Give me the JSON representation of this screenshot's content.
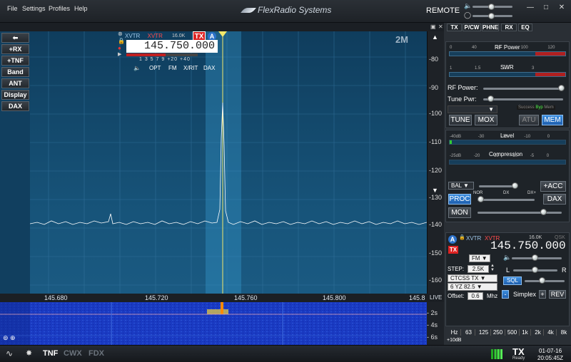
{
  "menubar": {
    "items": [
      "File",
      "Settings",
      "Profiles",
      "Help"
    ],
    "brand": "FlexRadio Systems",
    "remote": "REMOTE",
    "icons": [
      "speaker-icon",
      "headphones-icon"
    ],
    "window_buttons": [
      "—",
      "□",
      "✕"
    ]
  },
  "left_buttons": [
    "+RX",
    "+TNF",
    "Band",
    "ANT",
    "Display",
    "DAX"
  ],
  "panadapter": {
    "band": "2M",
    "db_scale": [
      "-80",
      "-90",
      "-100",
      "-110",
      "-120",
      "-130",
      "-140",
      "-150",
      "-160"
    ],
    "freq_labels": [
      "145.680",
      "145.720",
      "145.760",
      "145.800",
      "145.8"
    ],
    "live": "LIVE"
  },
  "slice": {
    "xvtr_left": "XVTR",
    "xvtr_right": "XVTR",
    "bandwidth": "16.0K",
    "tx": "TX",
    "letter": "A",
    "freq": "145.750.000",
    "scale": "1 3 5 7 9 +20 +40",
    "buttons": [
      "OPT",
      "FM",
      "X/RIT",
      "DAX"
    ]
  },
  "waterfall": {
    "times": [
      "2s",
      "4s",
      "6s"
    ]
  },
  "status": {
    "tnf": "TNF",
    "cwx": "CWX",
    "fdx": "FDX",
    "tx": "TX",
    "ready": "Ready",
    "date": "01-07-16",
    "time": "20:05:45Z"
  },
  "right_tabs": [
    "TX",
    "P/CW",
    "PHNE",
    "RX",
    "EQ"
  ],
  "tx_panel": {
    "rf_power_title": "RF Power",
    "rf_scale": [
      "0",
      "40",
      "80",
      "100",
      "120"
    ],
    "swr_title": "SWR",
    "swr_scale": [
      "1",
      "1.5",
      "2.5",
      "3"
    ],
    "rf_power_label": "RF Power:",
    "tune_pwr_label": "Tune Pwr:",
    "tune": "TUNE",
    "mox": "MOX",
    "atu": "ATU",
    "mem": "MEM",
    "atu_status": [
      "Success",
      "Byp",
      "Mem"
    ]
  },
  "phone_panel": {
    "level_title": "Level",
    "level_scale": [
      "-40dB",
      "-30",
      "-20",
      "-10",
      "0"
    ],
    "comp_title": "Compression",
    "comp_scale": [
      "-25dB",
      "-20",
      "-15",
      "-10",
      "-5",
      "0"
    ],
    "bal": "BAL",
    "acc": "+ACC",
    "proc": "PROC",
    "nor": "NOR",
    "dx": "DX",
    "dxplus": "DX+",
    "dax": "DAX",
    "mon": "MON"
  },
  "rx_panel": {
    "xvtr1": "XVTR",
    "xvtr2": "XVTR",
    "bw": "16.0K",
    "qsk": "QSK",
    "letter": "A",
    "tx": "TX",
    "freq": "145.750.000",
    "mode": "FM",
    "step_label": "STEP:",
    "step": "2.5K",
    "ctcss": "CTCSS TX",
    "tone": "6 YZ 82.5",
    "offset_label": "Offset:",
    "offset": "0.6",
    "mhz": "Mhz",
    "l": "L",
    "r": "R",
    "sql": "SQL",
    "minus": "-",
    "simplex": "Simplex",
    "plus": "+",
    "rev": "REV"
  },
  "eq_bar": {
    "hz": "Hz",
    "bands": [
      "63",
      "125",
      "250",
      "500",
      "1k",
      "2k",
      "4k",
      "8k"
    ],
    "gain": "+10dB"
  }
}
